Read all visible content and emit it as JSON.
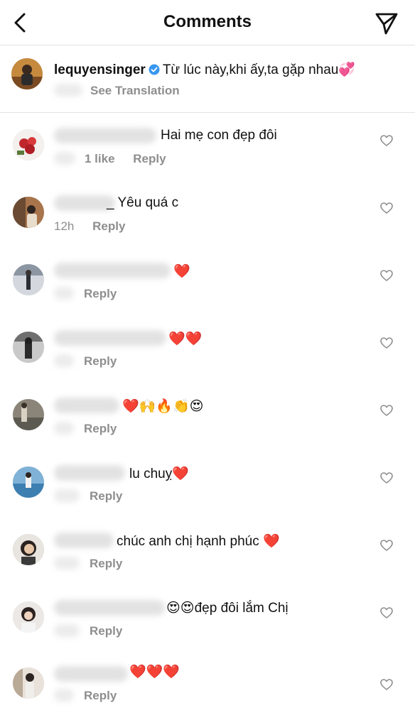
{
  "header": {
    "title": "Comments",
    "back_icon": "chevron-left-icon",
    "send_icon": "paper-plane-icon"
  },
  "caption": {
    "username": "lequyensinger",
    "text": "Từ lúc này,khi ấy,ta gặp nhau💞",
    "see_translation": "See Translation"
  },
  "comments": [
    {
      "text": "Hai mẹ con đẹp đôi",
      "time": "",
      "likes": "1 like",
      "reply": "Reply"
    },
    {
      "text": "_ Yêu quá c",
      "time": "12h",
      "likes": "",
      "reply": "Reply"
    },
    {
      "text": "❤️",
      "time": "",
      "likes": "",
      "reply": "Reply"
    },
    {
      "text": "❤️❤️",
      "time": "",
      "likes": "",
      "reply": "Reply"
    },
    {
      "text": "❤️🙌🔥👏😍",
      "time": "",
      "likes": "",
      "reply": "Reply"
    },
    {
      "text": "lu chuỵ❤️",
      "time": "",
      "likes": "",
      "reply": "Reply"
    },
    {
      "text": "chúc anh chị hạnh phúc ❤️",
      "time": "",
      "likes": "",
      "reply": "Reply"
    },
    {
      "text": "😍😍đẹp đôi lắm Chị",
      "time": "",
      "likes": "",
      "reply": "Reply"
    },
    {
      "text": "❤️❤️❤️",
      "time": "",
      "likes": "",
      "reply": "Reply"
    }
  ]
}
